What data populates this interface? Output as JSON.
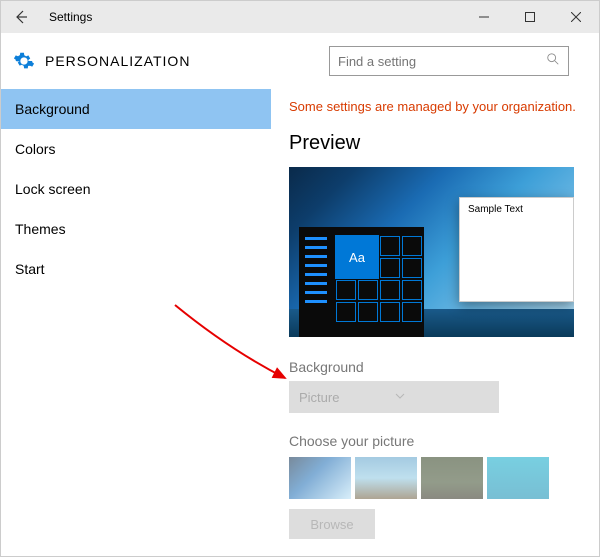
{
  "titlebar": {
    "app_title": "Settings"
  },
  "header": {
    "page_title": "PERSONALIZATION"
  },
  "search": {
    "placeholder": "Find a setting"
  },
  "sidebar": {
    "items": [
      {
        "label": "Background",
        "selected": true
      },
      {
        "label": "Colors",
        "selected": false
      },
      {
        "label": "Lock screen",
        "selected": false
      },
      {
        "label": "Themes",
        "selected": false
      },
      {
        "label": "Start",
        "selected": false
      }
    ]
  },
  "main": {
    "org_message": "Some settings are managed by your organization.",
    "preview_label": "Preview",
    "preview_window_text": "Sample Text",
    "preview_tile_text": "Aa",
    "background_label": "Background",
    "background_value": "Picture",
    "choose_label": "Choose your picture",
    "browse_label": "Browse"
  },
  "colors": {
    "accent": "#0078d7",
    "warning": "#d83b01"
  }
}
